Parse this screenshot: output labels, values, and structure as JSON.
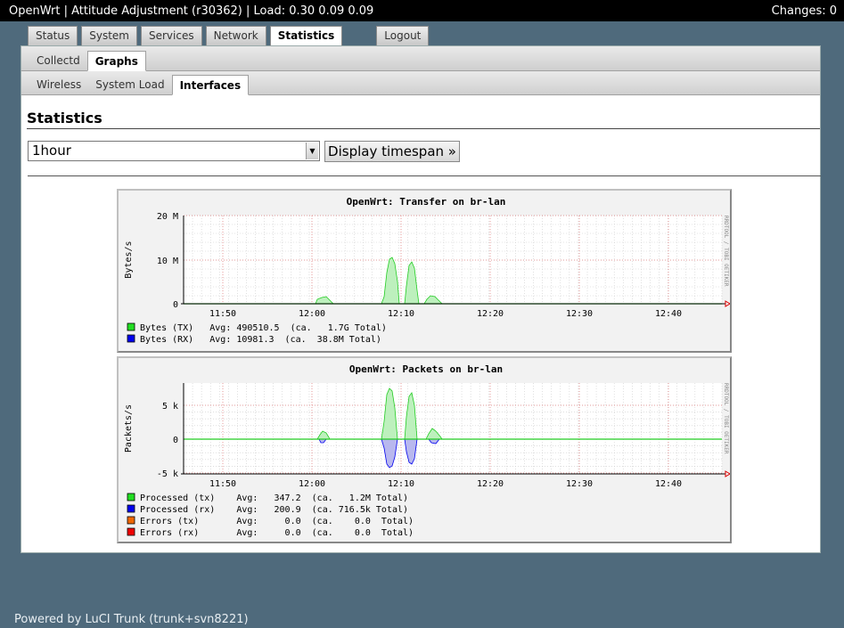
{
  "topbar": {
    "title": "OpenWrt | Attitude Adjustment (r30362) | Load: 0.30 0.09 0.09",
    "changes": "Changes: 0"
  },
  "main_tabs": [
    "Status",
    "System",
    "Services",
    "Network",
    "Statistics",
    "Logout"
  ],
  "sub_tabs": [
    "Collectd",
    "Graphs"
  ],
  "sub_tabs2": [
    "Wireless",
    "System Load",
    "Interfaces"
  ],
  "heading": "Statistics",
  "timespan": {
    "selected": "1hour",
    "button": "Display timespan »"
  },
  "graphs": [
    {
      "title": "OpenWrt: Transfer on br-lan",
      "side_label": "RRDTOOL / TOBI OETIKER",
      "ylabel": "Bytes/s",
      "yticks": [
        "20 M",
        "10 M",
        "0"
      ],
      "xticks": [
        "11:50",
        "12:00",
        "12:10",
        "12:20",
        "12:30",
        "12:40"
      ],
      "legend": [
        {
          "color": "#22dd22",
          "text": "Bytes (TX)   Avg: 490510.5  (ca.   1.7G Total)"
        },
        {
          "color": "#0000ee",
          "text": "Bytes (RX)   Avg: 10981.3  (ca.  38.8M Total)"
        }
      ]
    },
    {
      "title": "OpenWrt: Packets on br-lan",
      "side_label": "RRDTOOL / TOBI OETIKER",
      "ylabel": "Packets/s",
      "yticks": [
        "5 k",
        "0",
        "-5 k"
      ],
      "xticks": [
        "11:50",
        "12:00",
        "12:10",
        "12:20",
        "12:30",
        "12:40"
      ],
      "legend": [
        {
          "color": "#22dd22",
          "text": "Processed (tx)    Avg:   347.2  (ca.   1.2M Total)"
        },
        {
          "color": "#0000ee",
          "text": "Processed (rx)    Avg:   200.9  (ca. 716.5k Total)"
        },
        {
          "color": "#ee6600",
          "text": "Errors (tx)       Avg:     0.0  (ca.    0.0  Total)"
        },
        {
          "color": "#ee0000",
          "text": "Errors (rx)       Avg:     0.0  (ca.    0.0  Total)"
        }
      ]
    }
  ],
  "footer": "Powered by LuCI Trunk (trunk+svn8221)"
}
